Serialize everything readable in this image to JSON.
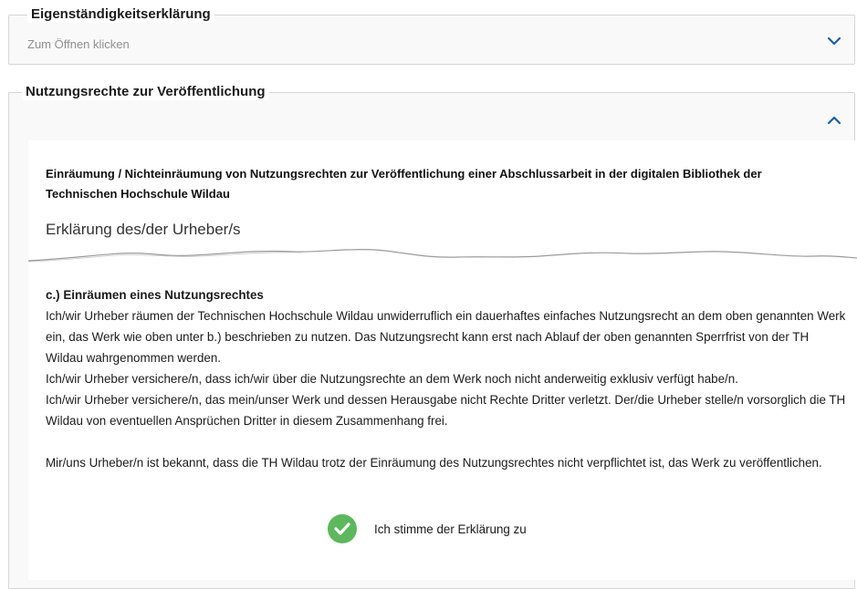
{
  "section1": {
    "title": "Eigenständigkeitserklärung",
    "hint": "Zum Öffnen klicken",
    "icon": "chevron-down-icon"
  },
  "section2": {
    "title": "Nutzungsrechte zur Veröffentlichung",
    "icon": "chevron-up-icon",
    "heading": "Einräumung / Nichteinräumung von Nutzungsrechten zur Veröffentlichung einer Abschlussarbeit in der digitalen Bibliothek der Technischen Hochschule Wildau",
    "subtitle": "Erklärung des/der Urheber/s",
    "subsection_title": "c.) Einräumen eines Nutzungsrechtes",
    "paragraph1": "Ich/wir Urheber räumen der Technischen Hochschule Wildau unwiderruflich ein dauerhaftes einfaches Nutzungsrecht an dem oben genannten Werk ein, das Werk wie oben unter b.) beschrieben zu nutzen. Das Nutzungsrecht kann erst nach Ablauf der oben genannten Sperrfrist von der TH Wildau wahrgenommen werden.",
    "paragraph2": "Ich/wir Urheber versichere/n, dass ich/wir über die Nutzungsrechte an dem Werk noch nicht anderweitig exklusiv verfügt habe/n.",
    "paragraph3": "Ich/wir Urheber versichere/n, das mein/unser Werk und dessen Herausgabe nicht Rechte Dritter verletzt. Der/die Urheber stelle/n vorsorglich die TH Wildau von eventuellen Ansprüchen Dritter in diesem Zusammenhang frei.",
    "paragraph4": "Mir/uns Urheber/n ist bekannt, dass die TH Wildau trotz der Einräumung des Nutzungsrechtes nicht verpflichtet ist, das Werk zu veröffentlichen.",
    "agree_label": "Ich stimme der Erklärung zu",
    "agree_checked": true
  },
  "colors": {
    "accent": "#1a5fa8",
    "check": "#5cb85c",
    "border": "#d6d6d6",
    "hint": "#8f8f8f"
  }
}
